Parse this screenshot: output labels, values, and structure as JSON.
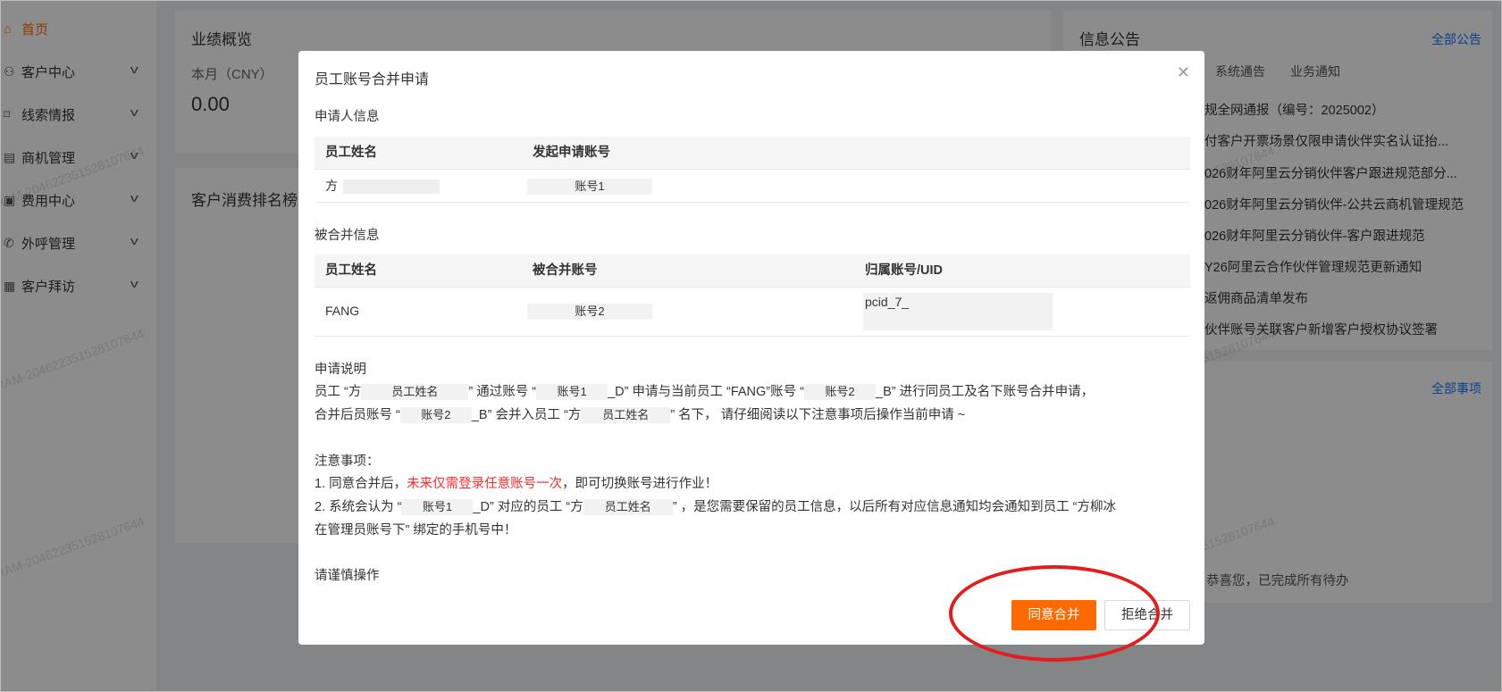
{
  "sidebar": {
    "items": [
      {
        "label": "首页",
        "icon": "home-icon"
      },
      {
        "label": "客户中心",
        "icon": "users-icon"
      },
      {
        "label": "线索情报",
        "icon": "flag-icon"
      },
      {
        "label": "商机管理",
        "icon": "list-icon"
      },
      {
        "label": "费用中心",
        "icon": "wallet-icon"
      },
      {
        "label": "外呼管理",
        "icon": "phone-icon"
      },
      {
        "label": "客户拜访",
        "icon": "calendar-icon"
      }
    ]
  },
  "performance": {
    "title": "业绩概览",
    "month_label": "本月（CNY）",
    "month_value": "0.00"
  },
  "ranking": {
    "title": "客户消费排名榜"
  },
  "notices": {
    "title": "信息公告",
    "all_link": "全部公告",
    "tabs": [
      "系统通告",
      "业务通知"
    ],
    "items": [
      "规全网通报（编号：2025002）",
      "付客户开票场景仅限申请伙伴实名认证抬...",
      "026财年阿里云分销伙伴客户跟进规范部分...",
      "026财年阿里云分销伙伴-公共云商机管理规范",
      "026财年阿里云分销伙伴-客户跟进规范",
      "Y26阿里云合作伙伴管理规范更新通知",
      "返佣商品清单发布",
      "伙伴账号关联客户新增客户授权协议签署"
    ]
  },
  "todos": {
    "all_link": "全部事项",
    "empty_text": "恭喜您，已完成所有待办"
  },
  "watermark": "RAM-204622351528107644",
  "modal": {
    "title": "员工账号合并申请",
    "applicant": {
      "section_title": "申请人信息",
      "headers": [
        "员工姓名",
        "发起申请账号"
      ],
      "row": {
        "name": "方",
        "account": "账号1"
      }
    },
    "merged": {
      "section_title": "被合并信息",
      "headers": [
        "员工姓名",
        "被合并账号",
        "归属账号/UID"
      ],
      "row": {
        "name": "FANG",
        "account": "账号2",
        "uid": "pcid_7_"
      }
    },
    "description": {
      "section_title": "申请说明",
      "t1": "员工 “方",
      "name_pill": "员工姓名",
      "t2": "” 通过账号 “",
      "acct1_pill": "账号1",
      "t3": "_D” 申请与当前员工 “FANG”账号 “",
      "acct2_pill": "账号2",
      "t4": "_B” 进行同员工及名下账号合并申请，",
      "t5": "合并后员账号 “",
      "t6": "_B” 会并入员工 “方",
      "t7": "” 名下， 请仔细阅读以下注意事项后操作当前申请 ~"
    },
    "notes": {
      "section_title": "注意事项：",
      "n1_pre": "1. 同意合并后，",
      "n1_red": "未来仅需登录任意账号一次",
      "n1_post": "，即可切换账号进行作业！",
      "n2_pre": "2. 系统会认为 “",
      "n2_mid": "_D” 对应的员工 “方",
      "n2_post": "” ，是您需要保留的员工信息，以后所有对应信息通知均会通知到员工 “方柳冰",
      "n2_line2": "在管理员账号下” 绑定的手机号中！"
    },
    "caution": "请谨慎操作",
    "agree_label": "同意合并",
    "reject_label": "拒绝合并"
  },
  "colors": {
    "accent": "#ff6a00",
    "link": "#1677ff",
    "highlight_circle": "#e31d1d",
    "warning_text": "#ff2b2b"
  }
}
